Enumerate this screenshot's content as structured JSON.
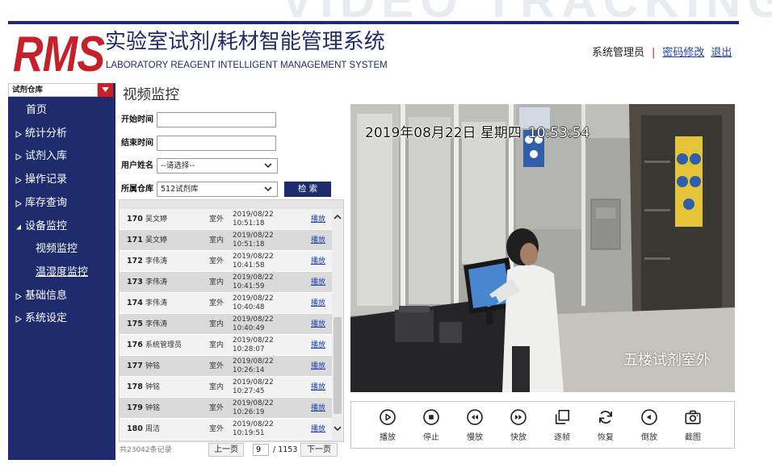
{
  "watermark": "VIDEO TRACKING",
  "colors": {
    "navy": "#1e2b6d",
    "brand_red": "#c6202b",
    "link_blue": "#1f3fa8"
  },
  "header": {
    "logo": "RMS",
    "title": "实验室试剂/耗材智能管理系统",
    "subtitle": "LABORATORY REAGENT INTELLIGENT MANAGEMENT SYSTEM",
    "user_name": "系统管理员",
    "separator": "|",
    "change_password": "密码修改",
    "logout": "退出"
  },
  "sidebar": {
    "warehouse": "试剂仓库",
    "items": [
      {
        "label": "首页"
      },
      {
        "label": "统计分析",
        "icon": "collapsed-arrow-icon"
      },
      {
        "label": "试剂入库",
        "icon": "collapsed-arrow-icon"
      },
      {
        "label": "操作记录",
        "icon": "collapsed-arrow-icon"
      },
      {
        "label": "库存查询",
        "icon": "collapsed-arrow-icon"
      },
      {
        "label": "设备监控",
        "icon": "expanded-arrow-icon",
        "children": [
          {
            "label": "视频监控"
          },
          {
            "label": "温湿度监控"
          }
        ]
      },
      {
        "label": "基础信息",
        "icon": "collapsed-arrow-icon"
      },
      {
        "label": "系统设定",
        "icon": "collapsed-arrow-icon"
      }
    ]
  },
  "page_title": "视频监控",
  "filters": {
    "start_time": {
      "label": "开始时间",
      "value": ""
    },
    "end_time": {
      "label": "结束时间",
      "value": ""
    },
    "user": {
      "label": "用户姓名",
      "value": "--请选择--"
    },
    "warehouse": {
      "label": "所属仓库",
      "value": "512试剂库"
    },
    "search_button": "检 索"
  },
  "records": {
    "rows": [
      {
        "id": "170",
        "name": "吴文婷",
        "location": "室外",
        "date": "2019/08/22",
        "time": "10:51:18",
        "action": "播放"
      },
      {
        "id": "171",
        "name": "吴文婷",
        "location": "室内",
        "date": "2019/08/22",
        "time": "10:51:18",
        "action": "播放"
      },
      {
        "id": "172",
        "name": "李伟涛",
        "location": "室外",
        "date": "2019/08/22",
        "time": "10:41:58",
        "action": "播放"
      },
      {
        "id": "173",
        "name": "李伟涛",
        "location": "室内",
        "date": "2019/08/22",
        "time": "10:41:59",
        "action": "播放"
      },
      {
        "id": "174",
        "name": "李伟涛",
        "location": "室外",
        "date": "2019/08/22",
        "time": "10:40:48",
        "action": "播放"
      },
      {
        "id": "175",
        "name": "李伟涛",
        "location": "室内",
        "date": "2019/08/22",
        "time": "10:40:49",
        "action": "播放"
      },
      {
        "id": "176",
        "name": "系统管理员",
        "location": "室内",
        "date": "2019/08/22",
        "time": "10:28:07",
        "action": "播放"
      },
      {
        "id": "177",
        "name": "钟铭",
        "location": "室外",
        "date": "2019/08/22",
        "time": "10:26:14",
        "action": "播放"
      },
      {
        "id": "178",
        "name": "钟铭",
        "location": "室内",
        "date": "2019/08/22",
        "time": "10:27:45",
        "action": "播放"
      },
      {
        "id": "179",
        "name": "钟铭",
        "location": "室外",
        "date": "2019/08/22",
        "time": "10:26:19",
        "action": "播放"
      },
      {
        "id": "180",
        "name": "周洁",
        "location": "室外",
        "date": "2019/08/22",
        "time": "10:19:51",
        "action": "播放"
      }
    ]
  },
  "pagination": {
    "total": "共23042条记录",
    "prev": "上一页",
    "current_page": "9",
    "total_pages": "/ 1153",
    "next": "下一页"
  },
  "video": {
    "date_text": "2019年08月22日 星期四",
    "time_text": "10:53:54",
    "camera_label": "五楼试剂室外"
  },
  "controls": [
    {
      "label": "播放",
      "icon": "play-icon"
    },
    {
      "label": "停止",
      "icon": "stop-icon"
    },
    {
      "label": "慢放",
      "icon": "slow-icon"
    },
    {
      "label": "快放",
      "icon": "fast-icon"
    },
    {
      "label": "逐帧",
      "icon": "frame-step-icon"
    },
    {
      "label": "恢复",
      "icon": "restore-icon"
    },
    {
      "label": "倒放",
      "icon": "reverse-icon"
    },
    {
      "label": "截图",
      "icon": "camera-icon"
    }
  ]
}
